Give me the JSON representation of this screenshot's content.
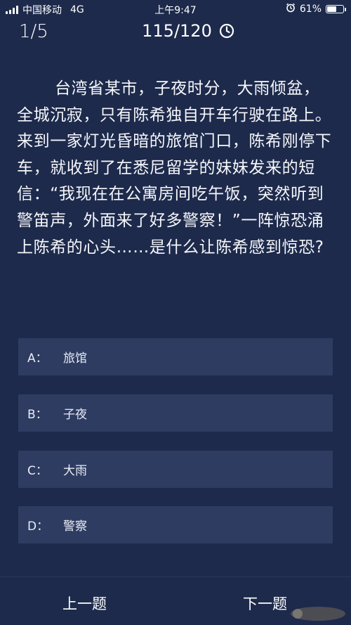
{
  "status_bar": {
    "carrier": "中国移动",
    "network": "4G",
    "time": "上午9:47",
    "battery_percent": "61%",
    "battery_level": 0.61
  },
  "header": {
    "progress": "1/5",
    "score": "115/120",
    "timer_icon": "clock-icon"
  },
  "question": {
    "text": "台湾省某市，子夜时分，大雨倾盆，全城沉寂，只有陈希独自开车行驶在路上。来到一家灯光昏暗的旅馆门口，陈希刚停下车，就收到了在悉尼留学的妹妹发来的短信：“我现在在公寓房间吃午饭，突然听到警笛声，外面来了好多警察！”一阵惊恐涌上陈希的心头……是什么让陈希感到惊恐?"
  },
  "options": [
    {
      "letter": "A：",
      "text": "旅馆"
    },
    {
      "letter": "B：",
      "text": "子夜"
    },
    {
      "letter": "C：",
      "text": "大雨"
    },
    {
      "letter": "D：",
      "text": "警察"
    }
  ],
  "nav": {
    "prev_label": "上一题",
    "next_label": "下一题"
  },
  "colors": {
    "background": "#1d2a4b",
    "option_background": "#2e3c62",
    "text": "#ffffff"
  }
}
